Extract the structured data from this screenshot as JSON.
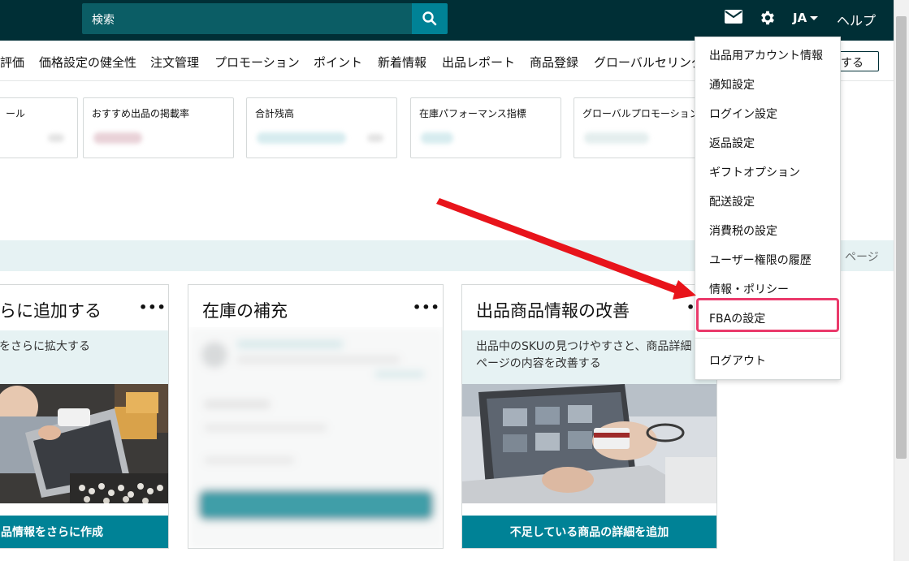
{
  "search": {
    "placeholder": "検索"
  },
  "header": {
    "language": "JA",
    "help": "ヘルプ"
  },
  "nav": {
    "items": [
      "評価",
      "価格設定の健全性",
      "注文管理",
      "プロモーション",
      "ポイント",
      "新着情報",
      "出品レポート",
      "商品登録",
      "グローバルセリング"
    ],
    "right_box": "する"
  },
  "metrics": [
    {
      "label": "ール"
    },
    {
      "label": "おすすめ出品の掲載率"
    },
    {
      "label": "合計残高"
    },
    {
      "label": "在庫パフォーマンス指標"
    },
    {
      "label": "グローバルプロモーション"
    }
  ],
  "strip": {
    "right_text": "ページ"
  },
  "cards": [
    {
      "title": "らに追加する",
      "desc": "をさらに拡大する",
      "cta": "品情報をさらに作成"
    },
    {
      "title": "在庫の補充"
    },
    {
      "title": "出品商品情報の改善",
      "desc_line1": "出品中のSKUの見つけやすさと、商品詳細",
      "desc_line2": "ページの内容を改善する",
      "cta": "不足している商品の詳細を追加"
    }
  ],
  "menu": {
    "items": [
      "出品用アカウント情報",
      "通知設定",
      "ログイン設定",
      "返品設定",
      "ギフトオプション",
      "配送設定",
      "消費税の設定",
      "ユーザー権限の履歴",
      "情報・ポリシー",
      "FBAの設定",
      "ログアウト"
    ],
    "highlighted": "FBAの設定"
  },
  "colors": {
    "topbar": "#002f36",
    "accent": "#008296",
    "highlight": "#ea3a6b",
    "arrow": "#e8141b"
  }
}
